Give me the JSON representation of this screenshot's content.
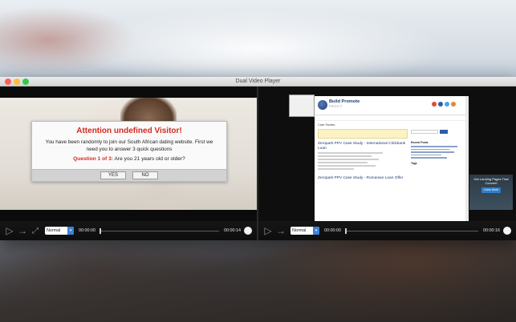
{
  "window": {
    "title": "Dual Video Player"
  },
  "left": {
    "dialog": {
      "title": "Attention undefined Visitor!",
      "body": "You have been randomly to join our South African dating website. First we need you to answer 3 quick questions",
      "question_number": "Question 1 of 3:",
      "question_text": "Are you 21 years old or older?",
      "yes_label": "YES",
      "no_label": "NO"
    },
    "controls": {
      "speed": "Normal",
      "time_current": "00:00:00",
      "time_total": "00:00:14"
    }
  },
  "right": {
    "site": {
      "logo_text": "Build Promote",
      "logo_sub": "PROFIT",
      "breadcrumb": "Case Studies",
      "post1_title": "Zeropark PPV Case Study - International Clickbank Loan",
      "post2_title": "Zeropark PPV Case Study - Romanian Loan Offer",
      "side_heading1": "Recent Posts",
      "side_heading2": "Tags",
      "ad_text": "Get Landing Pages That Convert!",
      "ad_cta": "Learn More"
    },
    "controls": {
      "speed": "Normal",
      "time_current": "00:00:00",
      "time_total": "00:00:16"
    }
  }
}
